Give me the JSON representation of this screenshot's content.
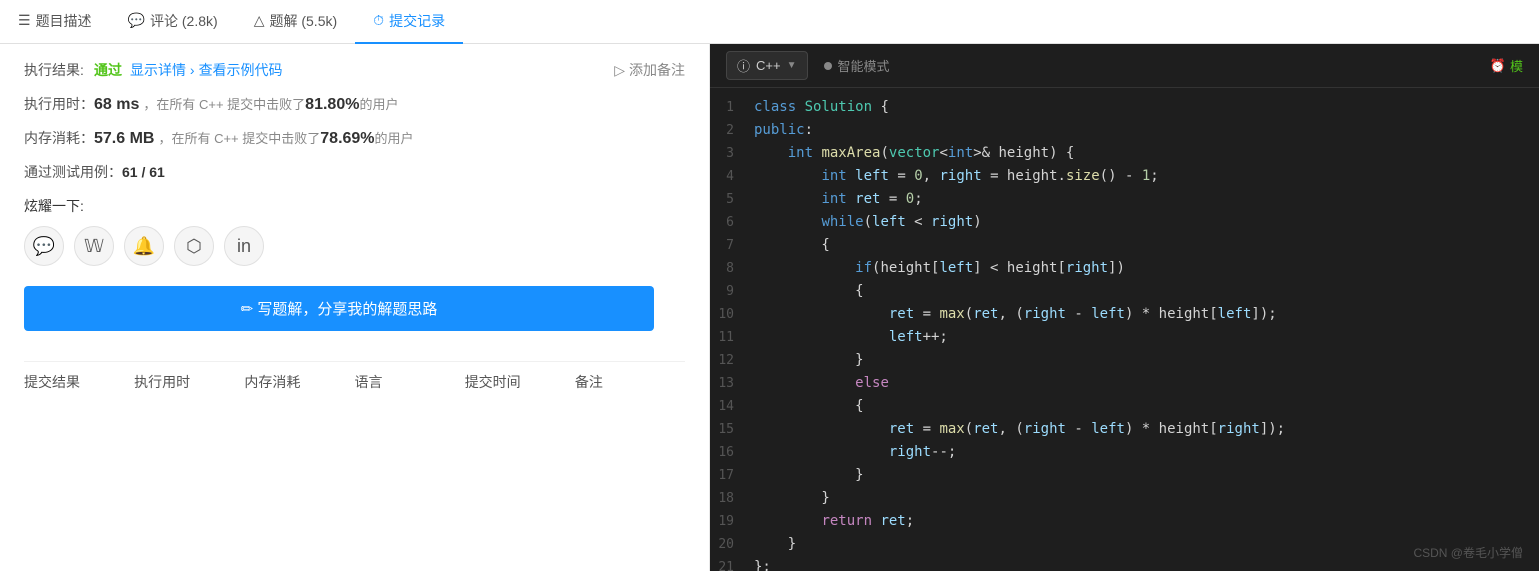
{
  "tabs": [
    {
      "id": "description",
      "icon": "☰",
      "label": "题目描述"
    },
    {
      "id": "comments",
      "icon": "💬",
      "label": "评论 (2.8k)"
    },
    {
      "id": "solutions",
      "icon": "△",
      "label": "题解 (5.5k)"
    },
    {
      "id": "submissions",
      "icon": "⏱",
      "label": "提交记录",
      "active": true
    }
  ],
  "result": {
    "label": "执行结果:",
    "status": "通过",
    "show_detail": "显示详情 ›",
    "view_example": "查看示例代码",
    "add_note": "添加备注"
  },
  "exec_time": {
    "label": "执行用时：",
    "value": "68 ms",
    "desc": "，在所有 C++ 提交中击败了",
    "percent": "81.80%",
    "desc2": "的用户"
  },
  "memory": {
    "label": "内存消耗：",
    "value": "57.6 MB",
    "desc": "，在所有 C++ 提交中击败了",
    "percent": "78.69%",
    "desc2": "的用户"
  },
  "test_cases": {
    "label": "通过测试用例：",
    "value": "61 / 61"
  },
  "share": {
    "label": "炫耀一下:",
    "icons": [
      "wechat",
      "weibo",
      "bell",
      "douban",
      "linkedin"
    ]
  },
  "write_btn": "✏ 写题解，分享我的解题思路",
  "table_headers": [
    "提交结果",
    "执行用时",
    "内存消耗",
    "语言",
    "提交时间",
    "备注"
  ],
  "code_toolbar": {
    "lang": "C++",
    "lang_icon": "ⓘ",
    "smart_mode": "智能模式",
    "right_text": "模"
  },
  "code_lines": [
    {
      "num": 1,
      "tokens": [
        {
          "t": "class ",
          "c": "kw"
        },
        {
          "t": "Solution",
          "c": "type"
        },
        {
          "t": " {",
          "c": "punct"
        }
      ]
    },
    {
      "num": 2,
      "tokens": [
        {
          "t": "public",
          "c": "kw"
        },
        {
          "t": ":",
          "c": "punct"
        }
      ]
    },
    {
      "num": 3,
      "tokens": [
        {
          "t": "    ",
          "c": ""
        },
        {
          "t": "int",
          "c": "kw"
        },
        {
          "t": " ",
          "c": ""
        },
        {
          "t": "maxArea",
          "c": "fn"
        },
        {
          "t": "(",
          "c": "punct"
        },
        {
          "t": "vector",
          "c": "type"
        },
        {
          "t": "<",
          "c": "op"
        },
        {
          "t": "int",
          "c": "kw"
        },
        {
          "t": ">&",
          "c": "op"
        },
        {
          "t": " height) {",
          "c": ""
        }
      ]
    },
    {
      "num": 4,
      "tokens": [
        {
          "t": "        ",
          "c": ""
        },
        {
          "t": "int",
          "c": "kw"
        },
        {
          "t": " ",
          "c": ""
        },
        {
          "t": "left",
          "c": "var"
        },
        {
          "t": " = ",
          "c": ""
        },
        {
          "t": "0",
          "c": "num"
        },
        {
          "t": ", ",
          "c": ""
        },
        {
          "t": "right",
          "c": "var"
        },
        {
          "t": " = height.",
          "c": ""
        },
        {
          "t": "size",
          "c": "fn"
        },
        {
          "t": "() - ",
          "c": ""
        },
        {
          "t": "1",
          "c": "num"
        },
        {
          "t": ";",
          "c": ""
        }
      ]
    },
    {
      "num": 5,
      "tokens": [
        {
          "t": "        ",
          "c": ""
        },
        {
          "t": "int",
          "c": "kw"
        },
        {
          "t": " ",
          "c": ""
        },
        {
          "t": "ret",
          "c": "var"
        },
        {
          "t": " = ",
          "c": ""
        },
        {
          "t": "0",
          "c": "num"
        },
        {
          "t": ";",
          "c": ""
        }
      ]
    },
    {
      "num": 6,
      "tokens": [
        {
          "t": "        ",
          "c": ""
        },
        {
          "t": "while",
          "c": "kw"
        },
        {
          "t": "(",
          "c": ""
        },
        {
          "t": "left",
          "c": "var"
        },
        {
          "t": " < ",
          "c": ""
        },
        {
          "t": "right",
          "c": "var"
        },
        {
          "t": ")",
          "c": ""
        }
      ]
    },
    {
      "num": 7,
      "tokens": [
        {
          "t": "        {",
          "c": ""
        }
      ]
    },
    {
      "num": 8,
      "tokens": [
        {
          "t": "            ",
          "c": ""
        },
        {
          "t": "if",
          "c": "kw"
        },
        {
          "t": "(height[",
          "c": ""
        },
        {
          "t": "left",
          "c": "var"
        },
        {
          "t": "] < height[",
          "c": ""
        },
        {
          "t": "right",
          "c": "var"
        },
        {
          "t": "])",
          "c": ""
        }
      ]
    },
    {
      "num": 9,
      "tokens": [
        {
          "t": "            {",
          "c": ""
        }
      ]
    },
    {
      "num": 10,
      "tokens": [
        {
          "t": "                ",
          "c": ""
        },
        {
          "t": "ret",
          "c": "var"
        },
        {
          "t": " = ",
          "c": ""
        },
        {
          "t": "max",
          "c": "fn"
        },
        {
          "t": "(",
          "c": ""
        },
        {
          "t": "ret",
          "c": "var"
        },
        {
          "t": ", (",
          "c": ""
        },
        {
          "t": "right",
          "c": "var"
        },
        {
          "t": " - ",
          "c": ""
        },
        {
          "t": "left",
          "c": "var"
        },
        {
          "t": ") * height[",
          "c": ""
        },
        {
          "t": "left",
          "c": "var"
        },
        {
          "t": "]);",
          "c": ""
        }
      ]
    },
    {
      "num": 11,
      "tokens": [
        {
          "t": "                ",
          "c": ""
        },
        {
          "t": "left",
          "c": "var"
        },
        {
          "t": "++;",
          "c": ""
        }
      ]
    },
    {
      "num": 12,
      "tokens": [
        {
          "t": "            }",
          "c": ""
        }
      ]
    },
    {
      "num": 13,
      "tokens": [
        {
          "t": "            ",
          "c": ""
        },
        {
          "t": "else",
          "c": "kw2"
        }
      ]
    },
    {
      "num": 14,
      "tokens": [
        {
          "t": "            {",
          "c": ""
        }
      ]
    },
    {
      "num": 15,
      "tokens": [
        {
          "t": "                ",
          "c": ""
        },
        {
          "t": "ret",
          "c": "var"
        },
        {
          "t": " = ",
          "c": ""
        },
        {
          "t": "max",
          "c": "fn"
        },
        {
          "t": "(",
          "c": ""
        },
        {
          "t": "ret",
          "c": "var"
        },
        {
          "t": ", (",
          "c": ""
        },
        {
          "t": "right",
          "c": "var"
        },
        {
          "t": " - ",
          "c": ""
        },
        {
          "t": "left",
          "c": "var"
        },
        {
          "t": ") * height[",
          "c": ""
        },
        {
          "t": "right",
          "c": "var"
        },
        {
          "t": "]);",
          "c": ""
        }
      ]
    },
    {
      "num": 16,
      "tokens": [
        {
          "t": "                ",
          "c": ""
        },
        {
          "t": "right",
          "c": "var"
        },
        {
          "t": "--;",
          "c": ""
        }
      ]
    },
    {
      "num": 17,
      "tokens": [
        {
          "t": "            }",
          "c": ""
        }
      ]
    },
    {
      "num": 18,
      "tokens": [
        {
          "t": "        }",
          "c": ""
        }
      ]
    },
    {
      "num": 19,
      "tokens": [
        {
          "t": "        ",
          "c": ""
        },
        {
          "t": "return",
          "c": "kw2"
        },
        {
          "t": " ",
          "c": ""
        },
        {
          "t": "ret",
          "c": "var"
        },
        {
          "t": ";",
          "c": ""
        }
      ]
    },
    {
      "num": 20,
      "tokens": [
        {
          "t": "    }",
          "c": ""
        }
      ]
    },
    {
      "num": 21,
      "tokens": [
        {
          "t": "};",
          "c": ""
        }
      ]
    }
  ],
  "watermark": "CSDN @卷毛小学僧"
}
